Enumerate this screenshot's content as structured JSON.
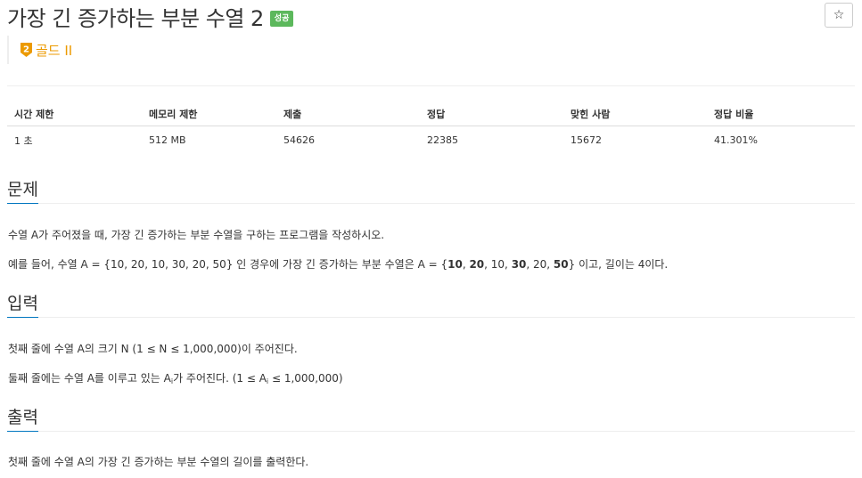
{
  "problem": {
    "title": "가장 긴 증가하는 부분 수열 2",
    "status_badge": "성공",
    "star_icon": "☆",
    "tier_number": "2",
    "tier_label": "골드 II"
  },
  "info_table": {
    "headers": [
      "시간 제한",
      "메모리 제한",
      "제출",
      "정답",
      "맞힌 사람",
      "정답 비율"
    ],
    "values": [
      "1 초",
      "512 MB",
      "54626",
      "22385",
      "15672",
      "41.301%"
    ]
  },
  "sections": {
    "description": {
      "title": "문제",
      "p1": "수열 A가 주어졌을 때, 가장 긴 증가하는 부분 수열을 구하는 프로그램을 작성하시오.",
      "p2_prefix": "예를 들어, 수열 A = {10, 20, 10, 30, 20, 50} 인 경우에 가장 긴 증가하는 부분 수열은 A = {",
      "p2_seq": [
        "10",
        ", ",
        "20",
        ", 10, ",
        "30",
        ", 20, ",
        "50"
      ],
      "p2_suffix": "} 이고, 길이는 4이다."
    },
    "input": {
      "title": "입력",
      "p1": "첫째 줄에 수열 A의 크기 N (1 ≤ N ≤ 1,000,000)이 주어진다.",
      "p2_a": "둘째 줄에는 수열 A를 이루고 있는 A",
      "p2_sub": "i",
      "p2_b": "가 주어진다. (1 ≤ A",
      "p2_sub2": "i",
      "p2_c": " ≤ 1,000,000)"
    },
    "output": {
      "title": "출력",
      "p1": "첫째 줄에 수열 A의 가장 긴 증가하는 부분 수열의 길이를 출력한다."
    }
  },
  "colors": {
    "success": "#5cb85c",
    "tier_gold": "#ec9a00",
    "section_underline": "#0076c0"
  }
}
